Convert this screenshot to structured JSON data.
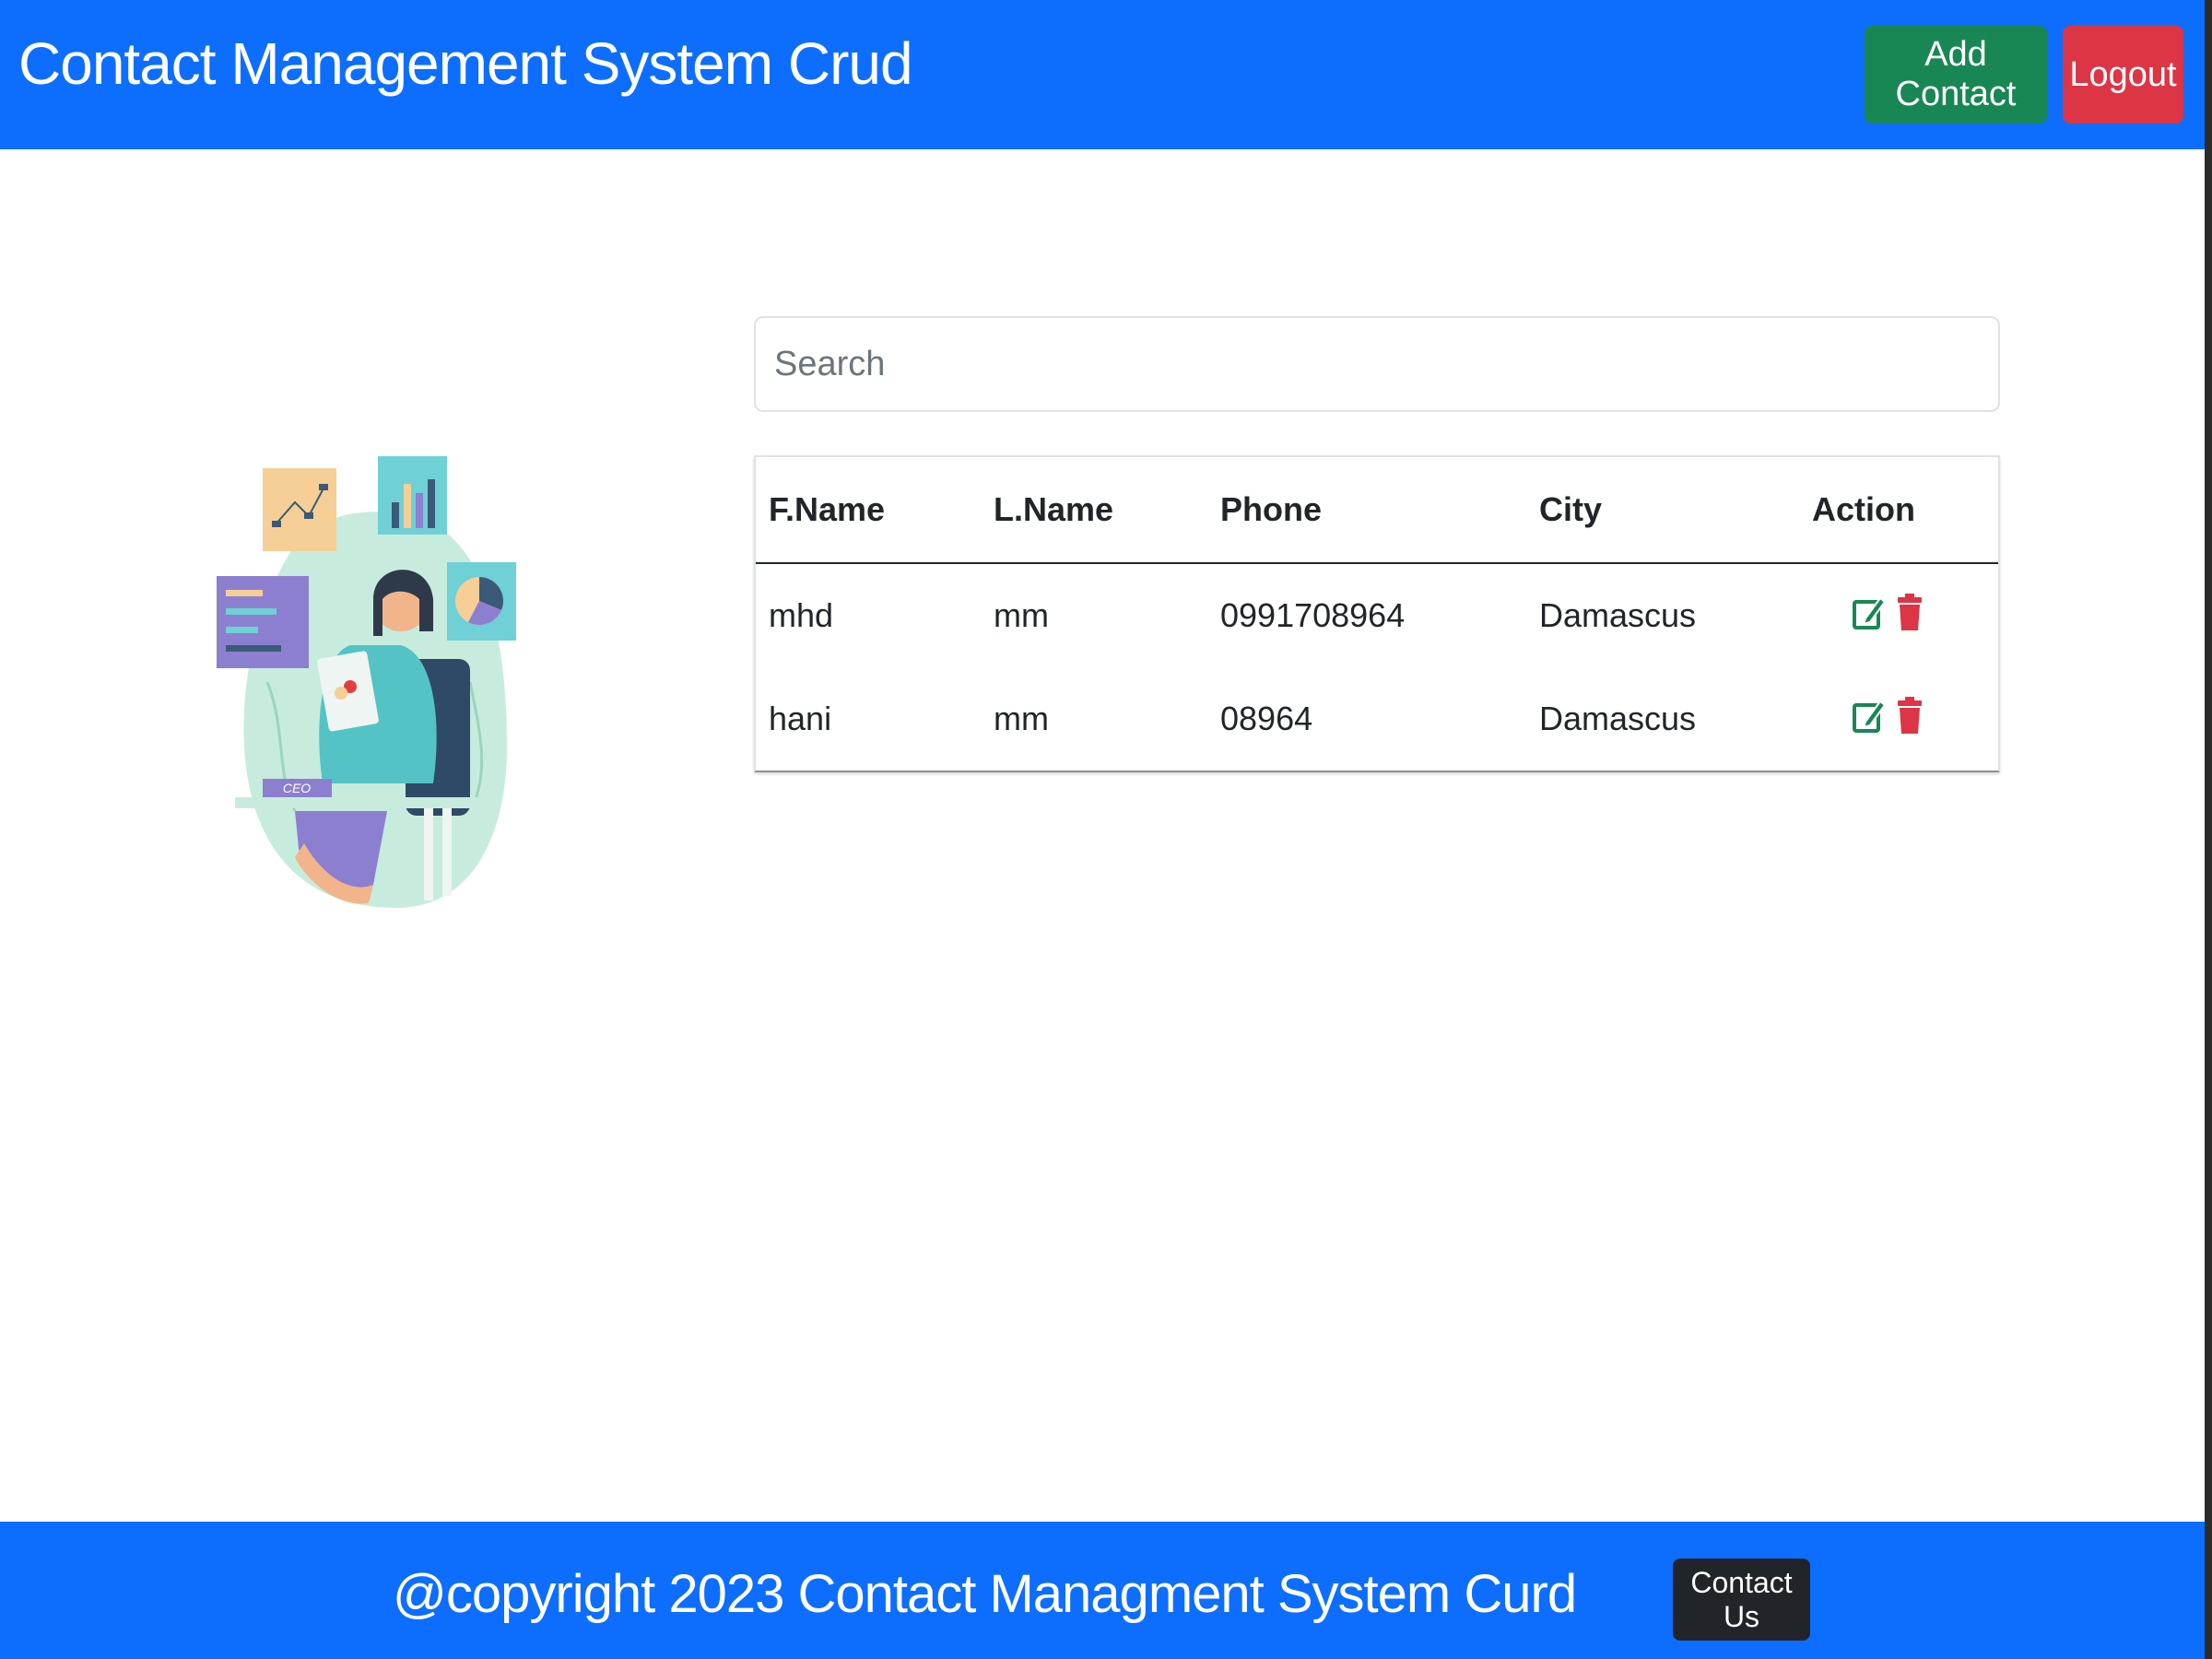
{
  "navbar": {
    "brand": "Contact Management System Crud",
    "add_contact_label": "Add Contact",
    "logout_label": "Logout"
  },
  "search": {
    "placeholder": "Search",
    "value": ""
  },
  "table": {
    "headers": [
      "F.Name",
      "L.Name",
      "Phone",
      "City",
      "Action"
    ],
    "rows": [
      {
        "fname": "mhd",
        "lname": "mm",
        "phone": "0991708964",
        "city": "Damascus"
      },
      {
        "fname": "hani",
        "lname": "mm",
        "phone": "08964",
        "city": "Damascus"
      }
    ],
    "action_icons": [
      "edit-icon",
      "trash-icon"
    ]
  },
  "illustration": {
    "badge_text": "CEO"
  },
  "footer": {
    "text": "@copyright 2023 Contact Managment System Curd",
    "contact_label": "Contact Us"
  },
  "colors": {
    "primary": "#0d6efd",
    "success": "#198754",
    "danger": "#dc3545",
    "dark": "#212529"
  }
}
